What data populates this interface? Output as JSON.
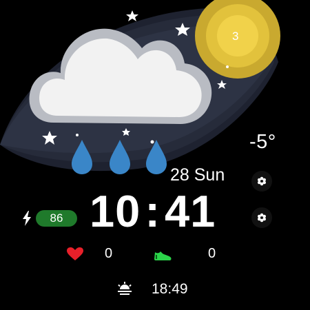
{
  "weather": {
    "temperature": "-5°",
    "moon_phase_number": "3",
    "condition_icon": "rain-cloud-icon"
  },
  "date": {
    "label": "28 Sun"
  },
  "time": {
    "hours": "10",
    "minutes": "41",
    "separator": ":"
  },
  "battery": {
    "level": "86",
    "icon": "bolt-icon",
    "color": "#1f7a2b"
  },
  "stats": {
    "heart_rate": "0",
    "steps": "0",
    "heart_icon": "heart-icon",
    "steps_icon": "shoe-icon"
  },
  "sunset": {
    "time": "18:49",
    "icon": "sunset-icon"
  },
  "complications": [
    {
      "icon": "flower-icon"
    },
    {
      "icon": "flower-icon"
    }
  ],
  "colors": {
    "background": "#000000",
    "sky": "#2a303f",
    "cloud": "#f2f2f2",
    "rain": "#3a86c8",
    "sun": "#f1d24a",
    "heart": "#e8202a",
    "steps": "#2bd44a"
  }
}
